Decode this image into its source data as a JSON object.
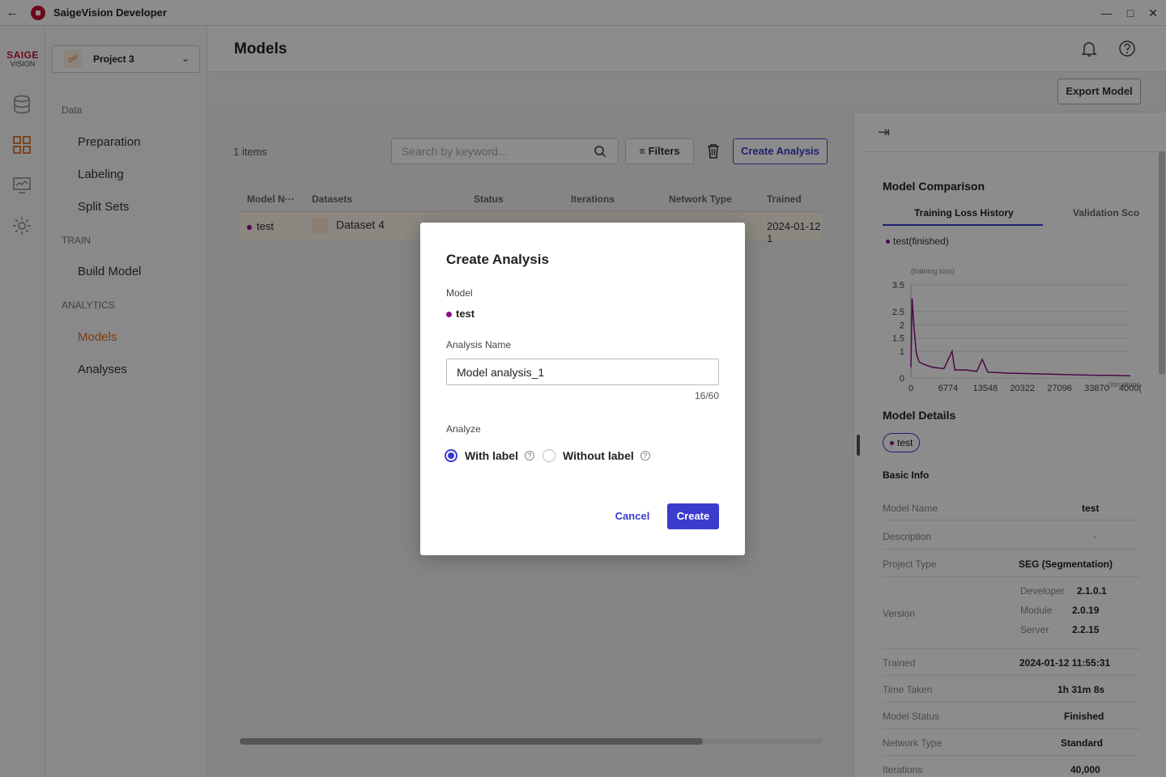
{
  "titlebar": {
    "app_title": "SaigeVision Developer"
  },
  "brand": {
    "line1": "SAIGE",
    "line2": "VISION"
  },
  "sidebar": {
    "project": "Project 3",
    "sections": [
      {
        "label": "Data",
        "items": [
          "Preparation",
          "Labeling",
          "Split Sets"
        ]
      },
      {
        "label": "TRAIN",
        "items": [
          "Build Model"
        ]
      },
      {
        "label": "ANALYTICS",
        "items": [
          "Models",
          "Analyses"
        ]
      }
    ],
    "active_item": "Models"
  },
  "header": {
    "page_title": "Models"
  },
  "toolbar": {
    "export_label": "Export Model",
    "items_count": "1 items",
    "search_placeholder": "Search by keyword...",
    "filters_label": "Filters",
    "create_analysis_label": "Create Analysis"
  },
  "table": {
    "columns": [
      "Model N···",
      "Datasets",
      "Status",
      "Iterations",
      "Network Type",
      "Trained"
    ],
    "rows": [
      {
        "model": "test",
        "dataset": "Dataset 4",
        "trained": "2024-01-12 1"
      }
    ]
  },
  "right_panel": {
    "comparison_title": "Model Comparison",
    "tabs": [
      "Training Loss History",
      "Validation Sco"
    ],
    "legend": "test(finished)",
    "chart_data": {
      "type": "line",
      "title": "",
      "ylabel": "(training loss)",
      "xlabel": "(iterations",
      "x_ticks": [
        "0",
        "6774",
        "13548",
        "20322",
        "27096",
        "33870",
        "4000("
      ],
      "y_ticks": [
        "3.5",
        "2.5",
        "2",
        "1.5",
        "1",
        "0"
      ],
      "ylim": [
        0,
        3.5
      ],
      "xlim": [
        0,
        40000
      ],
      "series": [
        {
          "name": "test(finished)",
          "color": "#8a0f86",
          "points": [
            [
              0,
              0.4
            ],
            [
              200,
              3.0
            ],
            [
              600,
              1.8
            ],
            [
              1000,
              0.9
            ],
            [
              1500,
              0.6
            ],
            [
              2500,
              0.5
            ],
            [
              4000,
              0.4
            ],
            [
              6000,
              0.35
            ],
            [
              7500,
              1.0
            ],
            [
              8000,
              0.3
            ],
            [
              10000,
              0.3
            ],
            [
              12000,
              0.25
            ],
            [
              13000,
              0.7
            ],
            [
              14000,
              0.22
            ],
            [
              16000,
              0.2
            ],
            [
              18000,
              0.18
            ],
            [
              20000,
              0.17
            ],
            [
              22000,
              0.16
            ],
            [
              24000,
              0.15
            ],
            [
              26000,
              0.14
            ],
            [
              28000,
              0.13
            ],
            [
              30000,
              0.12
            ],
            [
              32000,
              0.11
            ],
            [
              34000,
              0.1
            ],
            [
              36000,
              0.1
            ],
            [
              38000,
              0.09
            ],
            [
              40000,
              0.08
            ]
          ]
        }
      ]
    },
    "details_title": "Model Details",
    "details_pill": "test",
    "basic_info_title": "Basic Info",
    "basic_info": [
      {
        "key": "Model Name",
        "value": "test"
      },
      {
        "key": "Description",
        "value": "-"
      },
      {
        "key": "Project Type",
        "value": "SEG (Segmentation)"
      }
    ],
    "version": {
      "key": "Version",
      "rows": [
        {
          "key": "Developer",
          "value": "2.1.0.1"
        },
        {
          "key": "Module",
          "value": "2.0.19"
        },
        {
          "key": "Server",
          "value": "2.2.15"
        }
      ]
    },
    "more_info": [
      {
        "key": "Trained",
        "value": "2024-01-12 11:55:31"
      },
      {
        "key": "Time Taken",
        "value": "1h 31m 8s"
      },
      {
        "key": "Model Status",
        "value": "Finished"
      },
      {
        "key": "Network Type",
        "value": "Standard"
      },
      {
        "key": "Iterations",
        "value": "40,000"
      }
    ]
  },
  "modal": {
    "title": "Create Analysis",
    "model_label": "Model",
    "model_value": "test",
    "name_label": "Analysis Name",
    "name_value": "Model analysis_1",
    "counter": "16/60",
    "analyze_label": "Analyze",
    "option_with": "With label",
    "option_without": "Without label",
    "selected": "With label",
    "cancel_label": "Cancel",
    "create_label": "Create",
    "accent_color": "#3b3bce"
  }
}
